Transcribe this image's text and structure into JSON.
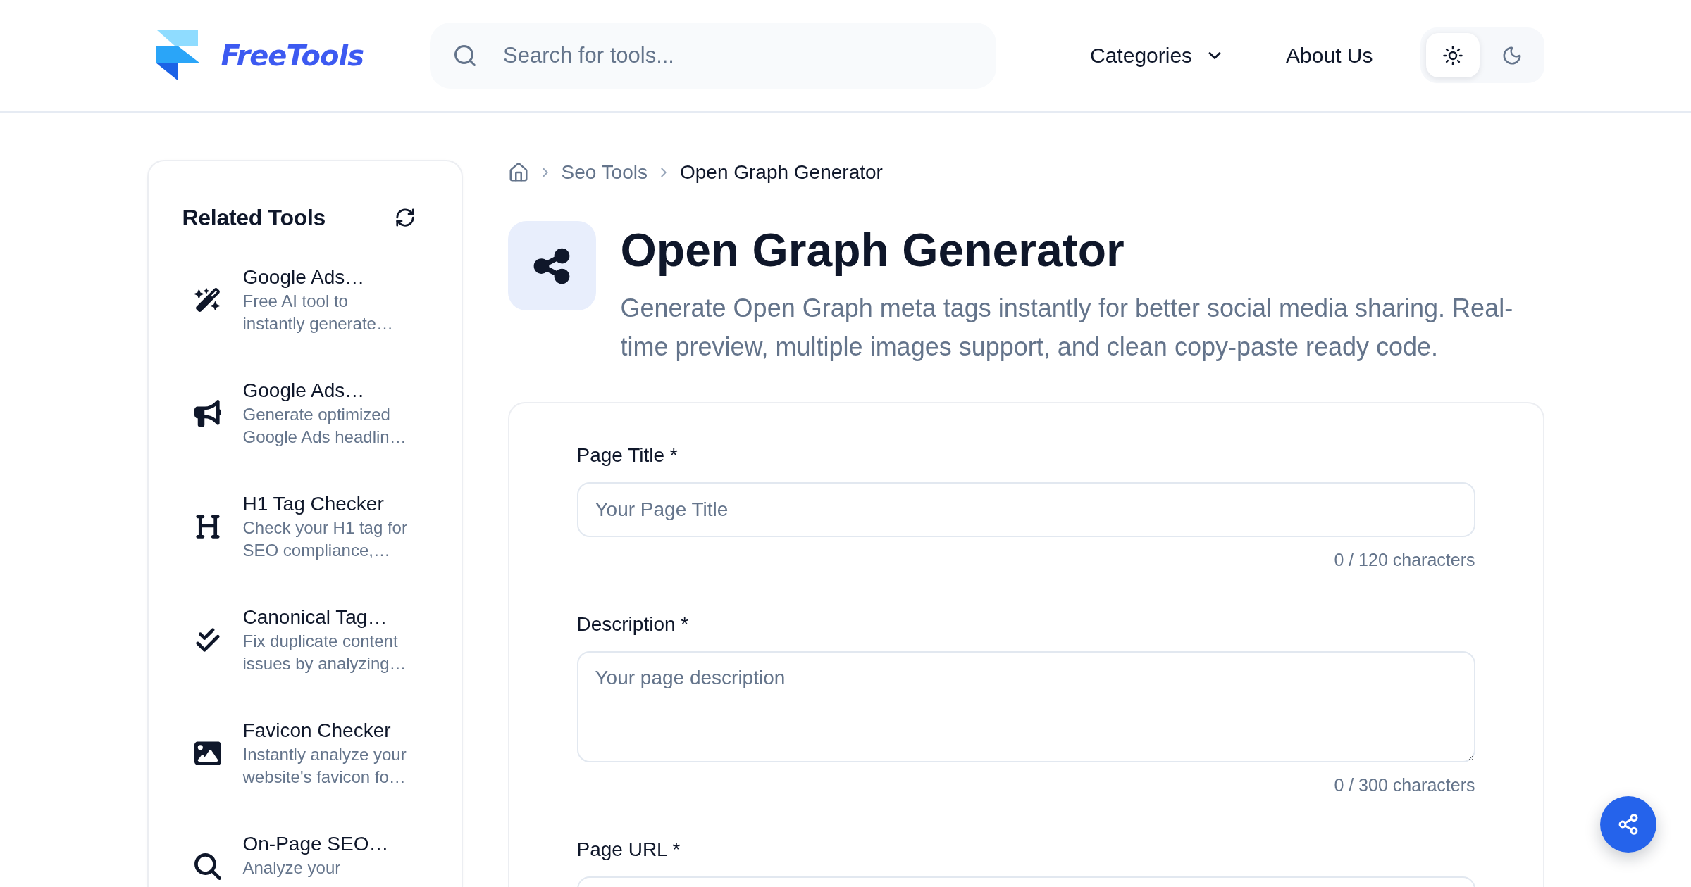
{
  "header": {
    "brand": "FreeTools",
    "search": {
      "placeholder": "Search for tools..."
    },
    "nav": [
      {
        "label": "Categories",
        "kind": "dropdown"
      },
      {
        "label": "About Us",
        "kind": "link"
      }
    ],
    "theme_toggle": [
      {
        "selected": true
      },
      {
        "selected": false
      }
    ]
  },
  "sidebar": {
    "title": "Related Tools",
    "items": [
      {
        "title": "Google Ads…",
        "description": "Free AI tool to instantly generate…"
      },
      {
        "title": "Google Ads…",
        "description": "Generate optimized Google Ads headlin…"
      },
      {
        "title": "H1 Tag Checker",
        "description": "Check your H1 tag for SEO compliance,…"
      },
      {
        "title": "Canonical Tag…",
        "description": "Fix duplicate content issues by analyzing…"
      },
      {
        "title": "Favicon Checker",
        "description": "Instantly analyze your website's favicon fo…"
      },
      {
        "title": "On-Page SEO…",
        "description": "Analyze your"
      }
    ]
  },
  "breadcrumb": [
    {
      "label": "Seo Tools",
      "current": false
    },
    {
      "label": "Open Graph Generator",
      "current": true
    }
  ],
  "page": {
    "title": "Open Graph Generator",
    "subtitle": "Generate Open Graph meta tags instantly for better social media sharing. Real-time preview, multiple images support, and clean copy-paste ready code."
  },
  "form": {
    "fields": [
      {
        "kind": "input",
        "label": "Page Title *",
        "placeholder": "Your Page Title",
        "counter": "0 / 120 characters"
      },
      {
        "kind": "textarea",
        "label": "Description *",
        "placeholder": "Your page description",
        "counter": "0 / 300 characters"
      },
      {
        "kind": "input",
        "label": "Page URL *"
      }
    ]
  }
}
